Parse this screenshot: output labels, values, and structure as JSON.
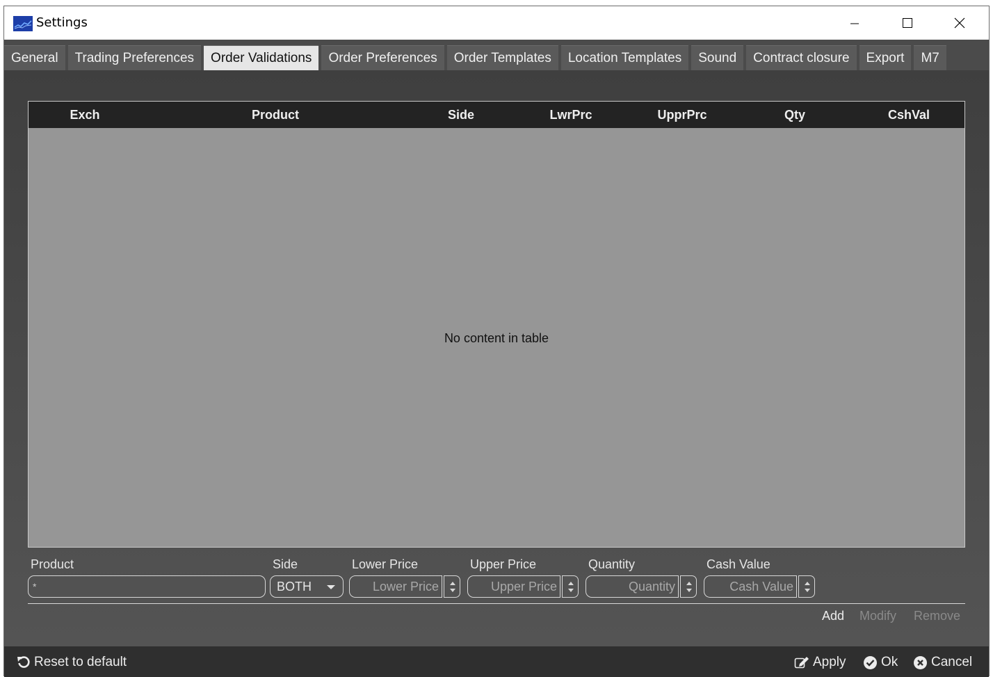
{
  "window": {
    "title": "Settings"
  },
  "tabs": [
    {
      "label": "General"
    },
    {
      "label": "Trading Preferences"
    },
    {
      "label": "Order Validations",
      "active": true
    },
    {
      "label": "Order Preferences"
    },
    {
      "label": "Order Templates"
    },
    {
      "label": "Location Templates"
    },
    {
      "label": "Sound"
    },
    {
      "label": "Contract closure"
    },
    {
      "label": "Export"
    },
    {
      "label": "M7"
    }
  ],
  "table": {
    "columns": [
      "Exch",
      "Product",
      "Side",
      "LwrPrc",
      "UpprPrc",
      "Qty",
      "CshVal"
    ],
    "rows": [],
    "empty_message": "No content in table"
  },
  "form": {
    "product": {
      "label": "Product",
      "value": "*"
    },
    "side": {
      "label": "Side",
      "value": "BOTH"
    },
    "lower_price": {
      "label": "Lower Price",
      "placeholder": "Lower Price"
    },
    "upper_price": {
      "label": "Upper Price",
      "placeholder": "Upper Price"
    },
    "quantity": {
      "label": "Quantity",
      "placeholder": "Quantity"
    },
    "cash_value": {
      "label": "Cash Value",
      "placeholder": "Cash Value"
    }
  },
  "actions": {
    "add": "Add",
    "modify": "Modify",
    "remove": "Remove"
  },
  "footer": {
    "reset": "Reset to default",
    "apply": "Apply",
    "ok": "Ok",
    "cancel": "Cancel"
  },
  "colors": {
    "window_bg": "#4b4b4b",
    "table_bg": "#969696",
    "header_bg": "#232323",
    "active_tab": "#e6e6e6"
  }
}
